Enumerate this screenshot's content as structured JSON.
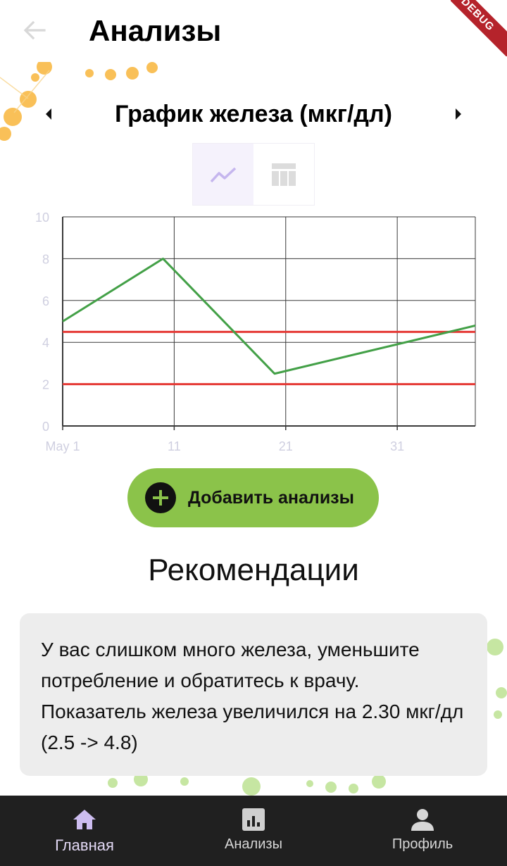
{
  "app": {
    "title": "Анализы",
    "debug_banner": "DEBUG"
  },
  "chart_header": {
    "title": "График железа (мкг/дл)"
  },
  "view_toggle": {
    "active": "chart",
    "icons": [
      "line-chart-icon",
      "table-icon"
    ]
  },
  "chart_data": {
    "type": "line",
    "title": "График железа (мкг/дл)",
    "xlabel": "",
    "ylabel": "",
    "x_ticks": [
      "May 1",
      "11",
      "21",
      "31"
    ],
    "xlim": [
      1,
      38
    ],
    "ylim": [
      0,
      10
    ],
    "y_ticks": [
      0,
      2,
      4,
      6,
      8,
      10
    ],
    "grid": true,
    "series": [
      {
        "color": "#43a047",
        "points": [
          [
            1,
            5.0
          ],
          [
            10,
            8.0
          ],
          [
            20,
            2.5
          ],
          [
            38,
            4.8
          ]
        ]
      }
    ],
    "reference_lines": [
      {
        "y": 4.5,
        "color": "#e53935"
      },
      {
        "y": 2.0,
        "color": "#e53935"
      }
    ]
  },
  "actions": {
    "add_label": "Добавить анализы"
  },
  "recommendations": {
    "title": "Рекомендации",
    "text": "У вас слишком много железа, уменьшите потребление и обратитесь к врачу. Показатель железа увеличился на 2.30 мкг/дл (2.5 -> 4.8)"
  },
  "bottom_nav": {
    "items": [
      {
        "label": "Главная",
        "icon": "home-icon",
        "active": true
      },
      {
        "label": "Анализы",
        "icon": "analytics-icon",
        "active": false
      },
      {
        "label": "Профиль",
        "icon": "person-icon",
        "active": false
      }
    ]
  },
  "colors": {
    "accent_green": "#8bc34a",
    "line_green": "#43a047",
    "reference_red": "#e53935",
    "nav_background": "#202020"
  }
}
